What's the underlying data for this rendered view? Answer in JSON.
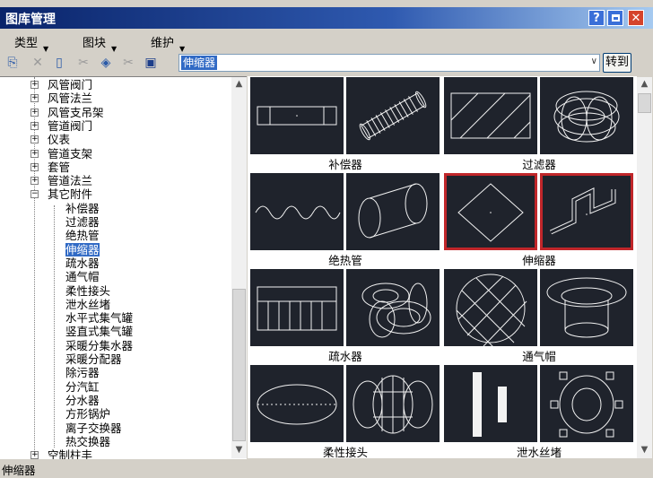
{
  "window": {
    "title": "图库管理"
  },
  "caption_buttons": {
    "help": "?",
    "close": "✕"
  },
  "menu": [
    {
      "label": "类型"
    },
    {
      "label": "图块"
    },
    {
      "label": "维护"
    }
  ],
  "search": {
    "value": "伸缩器",
    "go_label": "转到"
  },
  "tree": {
    "items": [
      {
        "label": "风管阀门",
        "level": 0,
        "expand": "+"
      },
      {
        "label": "风管法兰",
        "level": 0,
        "expand": "+"
      },
      {
        "label": "风管支吊架",
        "level": 0,
        "expand": "+"
      },
      {
        "label": "管道阀门",
        "level": 0,
        "expand": "+"
      },
      {
        "label": "仪表",
        "level": 0,
        "expand": "+"
      },
      {
        "label": "管道支架",
        "level": 0,
        "expand": "+"
      },
      {
        "label": "套管",
        "level": 0,
        "expand": "+"
      },
      {
        "label": "管道法兰",
        "level": 0,
        "expand": "+"
      },
      {
        "label": "其它附件",
        "level": 0,
        "expand": "−"
      },
      {
        "label": "补偿器",
        "level": 1
      },
      {
        "label": "过滤器",
        "level": 1
      },
      {
        "label": "绝热管",
        "level": 1
      },
      {
        "label": "伸缩器",
        "level": 1,
        "selected": true
      },
      {
        "label": "疏水器",
        "level": 1
      },
      {
        "label": "通气帽",
        "level": 1
      },
      {
        "label": "柔性接头",
        "level": 1
      },
      {
        "label": "泄水丝堵",
        "level": 1
      },
      {
        "label": "水平式集气罐",
        "level": 1
      },
      {
        "label": "竖直式集气罐",
        "level": 1
      },
      {
        "label": "采暖分集水器",
        "level": 1
      },
      {
        "label": "采暖分配器",
        "level": 1
      },
      {
        "label": "除污器",
        "level": 1
      },
      {
        "label": "分汽缸",
        "level": 1
      },
      {
        "label": "分水器",
        "level": 1
      },
      {
        "label": "方形锅炉",
        "level": 1
      },
      {
        "label": "离子交换器",
        "level": 1
      },
      {
        "label": "热交换器",
        "level": 1
      },
      {
        "label": "空制柱丰",
        "level": 0,
        "expand": "+"
      }
    ]
  },
  "gallery": {
    "items": [
      {
        "caption": "补偿器",
        "icon_2d": "compensator-2d-icon",
        "icon_3d": "compensator-3d-icon"
      },
      {
        "caption": "过滤器",
        "icon_2d": "filter-2d-icon",
        "icon_3d": "filter-3d-icon"
      },
      {
        "caption": "绝热管",
        "icon_2d": "insulated-pipe-2d-icon",
        "icon_3d": "insulated-pipe-3d-icon"
      },
      {
        "caption": "伸缩器",
        "icon_2d": "expansion-joint-2d-icon",
        "icon_3d": "expansion-joint-3d-icon",
        "selected": true
      },
      {
        "caption": "疏水器",
        "icon_2d": "steam-trap-2d-icon",
        "icon_3d": "steam-trap-3d-icon"
      },
      {
        "caption": "通气帽",
        "icon_2d": "vent-cap-2d-icon",
        "icon_3d": "vent-cap-3d-icon"
      },
      {
        "caption": "柔性接头",
        "icon_2d": "flexible-joint-2d-icon",
        "icon_3d": "flexible-joint-3d-icon"
      },
      {
        "caption": "泄水丝堵",
        "icon_2d": "drain-plug-2d-icon",
        "icon_3d": "drain-plug-3d-icon"
      }
    ]
  },
  "status": {
    "text": "伸缩器"
  },
  "colors": {
    "title_start": "#0a246a",
    "selection": "#316ac5",
    "thumb_bg": "#1f232c",
    "highlight": "#c0262a"
  }
}
